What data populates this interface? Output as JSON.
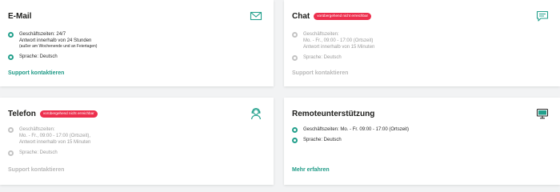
{
  "colors": {
    "accent": "#23a08c",
    "link": "#1e9a86",
    "badge": "#ed2f4d",
    "inactive": "#c4c4c4"
  },
  "cards": {
    "email": {
      "title": "E-Mail",
      "icon": "envelope-icon",
      "status": "available",
      "hours_line1": "Geschäftszeiten: 24/7",
      "hours_line2": "Antwort innerhalb von 24 Stunden",
      "hours_note": "(außer am Wochenende und an Feiertagen)",
      "language": "Sprache: Deutsch",
      "link": "Support kontaktieren"
    },
    "chat": {
      "title": "Chat",
      "badge": "vorübergehend nicht erreichbar",
      "icon": "chat-bubble-icon",
      "status": "unavailable",
      "hours_line1": "Geschäftszeiten:",
      "hours_line2": "Mo. - Fr., 09:00 - 17:00 (Ortszeit)",
      "hours_line3": "Antwort innerhalb von 15 Minuten",
      "language": "Sprache: Deutsch",
      "link": "Support kontaktieren"
    },
    "phone": {
      "title": "Telefon",
      "badge": "vorübergehend nicht erreichbar",
      "icon": "headset-agent-icon",
      "status": "unavailable",
      "hours_line1": "Geschäftszeiten:",
      "hours_line2": "Mo. - Fr., 09:00 - 17:00 (Ortszeit),",
      "hours_line3": "Antwort innerhalb von 15 Minuten",
      "language": "Sprache: Deutsch",
      "link": "Support kontaktieren"
    },
    "remote": {
      "title": "Remoteunterstützung",
      "icon": "remote-monitor-icon",
      "status": "available",
      "hours_line1": "Geschäftszeiten: Mo. - Fr. 09:00 - 17:00 (Ortszeit)",
      "language": "Sprache: Deutsch",
      "link": "Mehr erfahren"
    }
  }
}
